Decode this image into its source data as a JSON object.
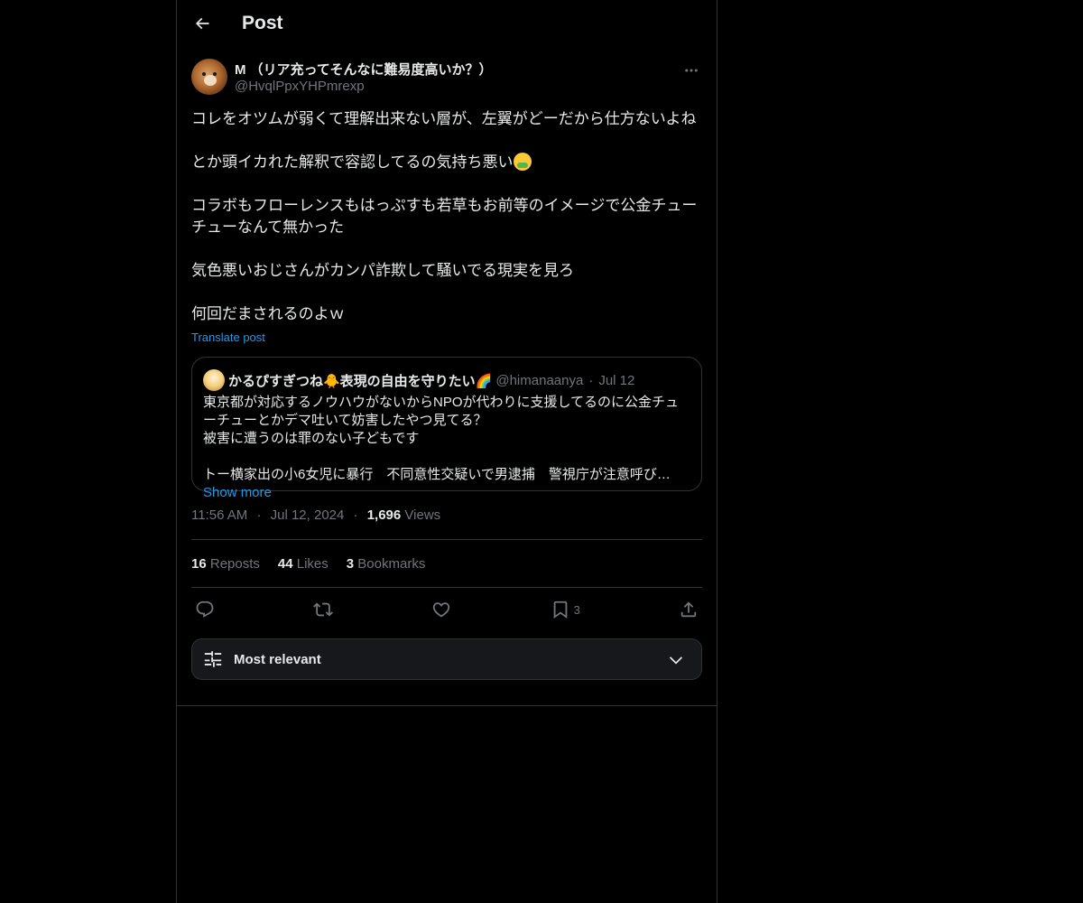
{
  "header": {
    "title": "Post"
  },
  "post": {
    "author_name": "M （リア充ってそんなに難易度高いか？）",
    "author_handle": "@HvqlPpxYHPmrexp",
    "paragraphs": [
      "コレをオツムが弱くて理解出来ない層が、左翼がどーだから仕方ないよね",
      "とか頭イカれた解釈で容認してるの気持ち悪い",
      "コラボもフローレンスもはっぷすも若草もお前等のイメージで公金チューチューなんて無かった",
      "気色悪いおじさんがカンパ詐欺して騒いでる現実を見ろ",
      "何回だまされるのよｗ"
    ],
    "emoji": "face-vomiting",
    "translate_label": "Translate post",
    "time": "11:56 AM",
    "date": "Jul 12, 2024",
    "views_count": "1,696",
    "views_label": "Views"
  },
  "quote": {
    "name": "かるぴすぎつね🐥表現の自由を守りたい🌈",
    "handle": "@himanaanya",
    "date": "Jul 12",
    "lines": [
      "東京都が対応するノウハウがないからNPOが代わりに支援してるのに公金チュ",
      "ーチューとかデマ吐いて妨害したやつ見てる？",
      "被害に遭うのは罪のない子どもです"
    ],
    "truncated_line": "トー横家出の小6女児に暴行　不同意性交疑いで男逮捕　警視庁が注意呼びか...",
    "show_more": "Show more"
  },
  "stats": {
    "reposts_count": "16",
    "reposts_label": "Reposts",
    "likes_count": "44",
    "likes_label": "Likes",
    "bookmarks_count": "3",
    "bookmarks_label": "Bookmarks"
  },
  "actions": {
    "bookmark_count": "3"
  },
  "sort": {
    "label": "Most relevant"
  },
  "colors": {
    "background": "#000000",
    "text": "#e7e9ea",
    "muted": "#71767b",
    "accent": "#1d9bf0",
    "border": "#2f3336"
  }
}
